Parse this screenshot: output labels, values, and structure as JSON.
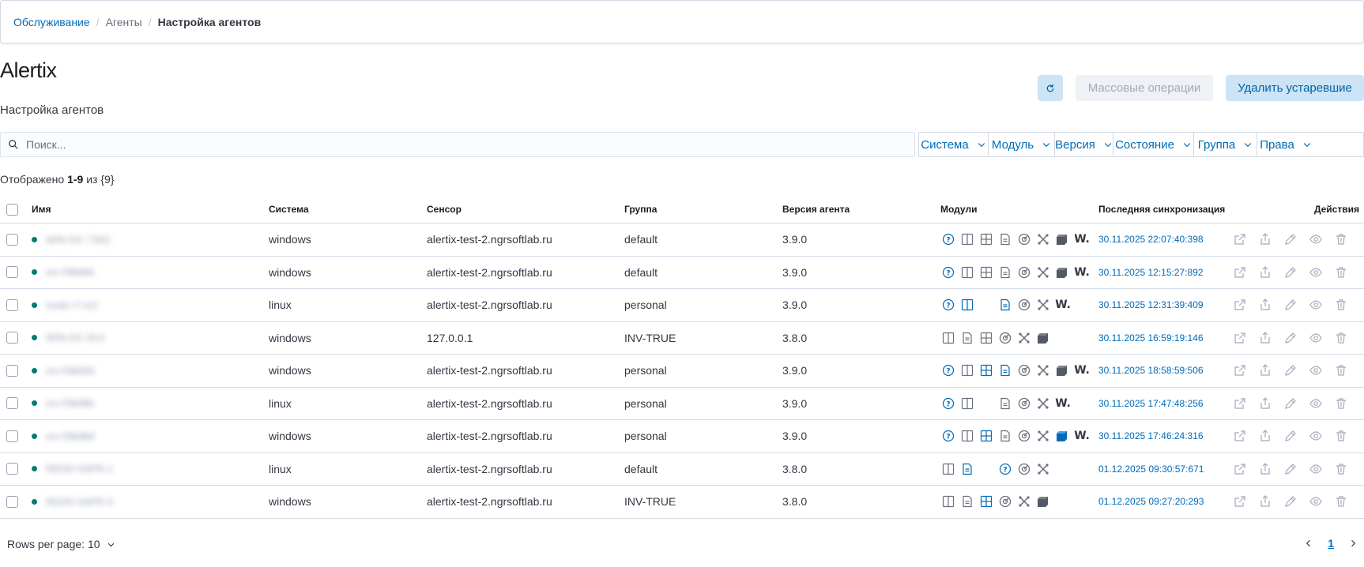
{
  "breadcrumb": {
    "items": [
      "Обслуживание",
      "Агенты",
      "Настройка агентов"
    ],
    "separator": "/"
  },
  "page": {
    "title": "Alertix",
    "subtitle": "Настройка агентов"
  },
  "header_actions": {
    "refresh_icon": "refresh-icon",
    "bulk_label": "Массовые операции",
    "delete_label": "Удалить устаревшие"
  },
  "search": {
    "placeholder": "Поиск...",
    "value": ""
  },
  "filters": [
    "Система",
    "Модуль",
    "Версия",
    "Состояние",
    "Группа",
    "Права"
  ],
  "summary": {
    "prefix": "Отображено",
    "range": "1-9",
    "of": "из",
    "total": "{9}"
  },
  "table": {
    "headers": {
      "name": "Имя",
      "system": "Система",
      "sensor": "Сенсор",
      "group": "Группа",
      "version": "Версия агента",
      "modules": "Модули",
      "sync": "Последняя синхронизация",
      "actions": "Действия"
    },
    "rows": [
      {
        "name": "WIN-DC-7362",
        "system": "windows",
        "sensor": "alertix-test-2.ngrsoftlab.ru",
        "group": "default",
        "version": "3.9.0",
        "modules": [
          "help",
          "columns",
          "grid",
          "doc",
          "gauge",
          "tools",
          "cube",
          "w"
        ],
        "sync": "30.11.2025 22:07:40:398"
      },
      {
        "name": "srv-f38d6b",
        "system": "windows",
        "sensor": "alertix-test-2.ngrsoftlab.ru",
        "group": "default",
        "version": "3.9.0",
        "modules": [
          "help",
          "columns",
          "grid",
          "doc",
          "gauge",
          "tools",
          "cube",
          "w"
        ],
        "sync": "30.11.2025 12:15:27:892"
      },
      {
        "name": "node-r7-lx2",
        "system": "linux",
        "sensor": "alertix-test-2.ngrsoftlab.ru",
        "group": "personal",
        "version": "3.9.0",
        "modules": [
          "help",
          "columns*",
          "blank",
          "doc*",
          "gauge",
          "tools",
          "w"
        ],
        "sync": "30.11.2025 12:31:39:409"
      },
      {
        "name": "WIN-DC-813",
        "system": "windows",
        "sensor": "127.0.0.1",
        "group": "INV-TRUE",
        "version": "3.8.0",
        "modules": [
          "columns",
          "doc",
          "grid",
          "gauge",
          "tools",
          "cube"
        ],
        "sync": "30.11.2025 16:59:19:146"
      },
      {
        "name": "srv-f38d93",
        "system": "windows",
        "sensor": "alertix-test-2.ngrsoftlab.ru",
        "group": "personal",
        "version": "3.9.0",
        "modules": [
          "help",
          "columns",
          "grid*",
          "doc*",
          "gauge",
          "tools",
          "cube",
          "w"
        ],
        "sync": "30.11.2025 18:58:59:506"
      },
      {
        "name": "srv-f38d8b",
        "system": "linux",
        "sensor": "alertix-test-2.ngrsoftlab.ru",
        "group": "personal",
        "version": "3.9.0",
        "modules": [
          "help",
          "columns",
          "blank",
          "doc",
          "gauge",
          "tools",
          "w"
        ],
        "sync": "30.11.2025 17:47:48:256"
      },
      {
        "name": "srv-f38d8d",
        "system": "windows",
        "sensor": "alertix-test-2.ngrsoftlab.ru",
        "group": "personal",
        "version": "3.9.0",
        "modules": [
          "help",
          "columns",
          "grid*",
          "doc",
          "gauge",
          "tools",
          "cube*",
          "w"
        ],
        "sync": "30.11.2025 17:46:24:316"
      },
      {
        "name": "RED0-VAPR-1",
        "system": "linux",
        "sensor": "alertix-test-2.ngrsoftlab.ru",
        "group": "default",
        "version": "3.8.0",
        "modules": [
          "columns",
          "doc*",
          "blank",
          "help",
          "gauge",
          "tools"
        ],
        "sync": "01.12.2025 09:30:57:671"
      },
      {
        "name": "RED0-VAPR-3",
        "system": "windows",
        "sensor": "alertix-test-2.ngrsoftlab.ru",
        "group": "INV-TRUE",
        "version": "3.8.0",
        "modules": [
          "columns",
          "doc",
          "grid*",
          "gauge",
          "tools",
          "cube"
        ],
        "sync": "01.12.2025 09:27:20:293"
      }
    ],
    "row_actions": [
      "external-link-icon",
      "export-icon",
      "pencil-icon",
      "eye-icon",
      "trash-icon"
    ]
  },
  "pagination": {
    "rows_per_page_label": "Rows per page: 10",
    "current_page": "1"
  },
  "colors": {
    "link": "#006bb8",
    "status_dot": "#017d73",
    "icon_gray": "#69707d",
    "icon_active": "#006bb8"
  }
}
